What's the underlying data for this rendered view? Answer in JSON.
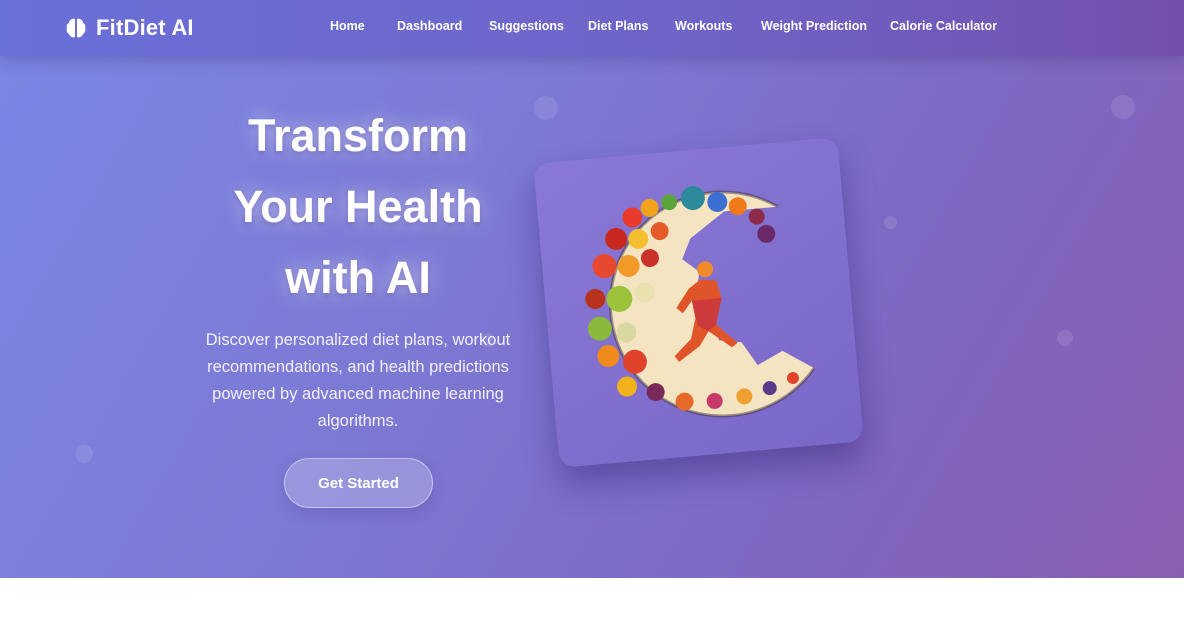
{
  "brand": {
    "name": "FitDiet AI",
    "icon": "brain-icon"
  },
  "nav": {
    "items": [
      {
        "label": "Home"
      },
      {
        "label": "Dashboard"
      },
      {
        "label": "Suggestions"
      },
      {
        "label": "Diet Plans"
      },
      {
        "label": "Workouts"
      },
      {
        "label": "Weight Prediction"
      },
      {
        "label": "Calorie Calculator"
      }
    ]
  },
  "hero": {
    "title_line1": "Transform",
    "title_line2": "Your Health",
    "title_line3": "with AI",
    "description": "Discover personalized diet plans, workout recommendations, and health predictions powered by advanced machine learning algorithms.",
    "cta_label": "Get Started",
    "image_subject": "runner-fruit-vegetable-illustration"
  },
  "colors": {
    "hero_gradient_start": "#7b86e4",
    "hero_gradient_end": "#8a5fb3",
    "text": "#ffffff"
  }
}
